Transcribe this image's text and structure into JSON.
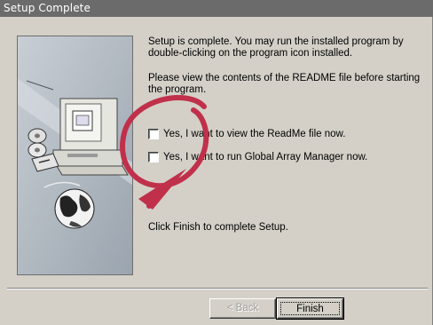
{
  "window": {
    "title": "Setup Complete"
  },
  "content": {
    "paragraph1": "Setup is complete.  You may run the installed program by double-clicking on the program icon installed.",
    "paragraph2": "Please view the contents of the README file before starting the program.",
    "checkbox_readme_label": "Yes, I want to view the ReadMe file now.",
    "checkbox_readme_checked": false,
    "checkbox_run_label": "Yes, I want to run Global Array Manager now.",
    "checkbox_run_checked": false,
    "finish_instruction": "Click Finish to complete Setup."
  },
  "buttons": {
    "back_label": "< Back",
    "back_enabled": false,
    "finish_label": "Finish"
  },
  "icons": {
    "side_panel": [
      "monitor-computer-icon",
      "cd-disc-icon",
      "floppy-disk-icon",
      "globe-icon"
    ],
    "overlay": "red-circle-arrow-annotation"
  },
  "colors": {
    "titlebar": "#6b6b6b",
    "dialog_bg": "#d4d0c8",
    "annotation": "#c0304a"
  }
}
